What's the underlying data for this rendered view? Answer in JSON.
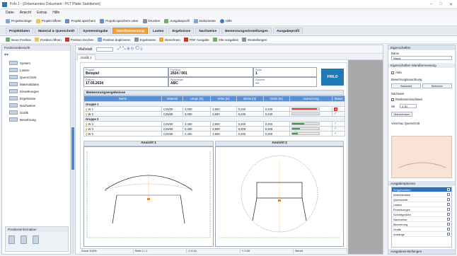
{
  "window": {
    "title": "Frilo 1 - [Unbenanntes Dokument - PLT Platte Stahlbeton]",
    "controls": [
      "–",
      "□",
      "✕"
    ]
  },
  "menu": [
    "Datei",
    "Ansicht",
    "Extras",
    "Hilfe"
  ],
  "toolbar1": [
    "Projektvorlage",
    "Projekt öffnen",
    "Projekt speichern",
    "Projekt speichern unter",
    "Drucken",
    "Ausgabeprofil",
    "Dokumente",
    "Hilfe"
  ],
  "ribbon_tabs": [
    "Projektdaten",
    "Material & Querschnitt",
    "Systemeingabe",
    "Wandbemessung",
    "Lasten",
    "Ergebnisse",
    "Nachweise",
    "Bemessungseinstellungen",
    "Ausgabeprofil"
  ],
  "ribbon_active": 3,
  "toolbar2": [
    "Neue Position",
    "Position öffnen",
    "Position löschen",
    "Position duplizieren",
    "Ergebnisse",
    "Berechnen",
    "PDF Ausgabe",
    "Alle Ausgaben",
    "Einstellungen"
  ],
  "left_pane": {
    "title": "Positionsübersicht",
    "items": [
      "System",
      "Lasten",
      "Querschnitt",
      "Materialdaten",
      "Einwirkungen",
      "Ergebnisse",
      "Nachweise",
      "Grafik",
      "Bewehrung"
    ],
    "footer_title": "Positionsinformation"
  },
  "main": {
    "toolbar_label": "Maßstab",
    "tab": "Grafik 1",
    "header": {
      "project_label": "Projekt",
      "project_value": "Beispiel",
      "position_label": "Position",
      "position_value": "2024 / 001",
      "date_label": "Datum",
      "date_value": "17.05.2024",
      "page_label": "Seite",
      "page_value": "1",
      "editor_label": "Bearbeiter",
      "editor_value": "ABC",
      "system_label": "System",
      "system_value": "—",
      "logo": "FRILO"
    },
    "section_title": "Bemessungsergebnisse",
    "table": {
      "headers": [
        "Name",
        "Material",
        "Länge [m]",
        "Höhe [m]",
        "Breite [m]",
        "Dicke [m]",
        "Ausnutzung",
        "Status"
      ],
      "groups": [
        {
          "name": "Gruppe 1",
          "rows": [
            {
              "name": "W 1",
              "mat": "C25/30",
              "l": "3,000",
              "h": "2,500",
              "b": "0,240",
              "d": "0,240",
              "util": 0.92,
              "color": "#d84e45",
              "status": "error"
            },
            {
              "name": "W 2",
              "mat": "C25/30",
              "l": "3,000",
              "h": "2,500",
              "b": "0,240",
              "d": "0,240",
              "util": 0.0,
              "color": "#d84e45",
              "status": "ok"
            }
          ]
        },
        {
          "name": "Gruppe 2",
          "rows": [
            {
              "name": "W 3",
              "mat": "C25/30",
              "l": "2,400",
              "h": "2,500",
              "b": "0,200",
              "d": "0,200",
              "util": 0.45,
              "color": "#3aa14a",
              "status": "ok"
            },
            {
              "name": "W 4",
              "mat": "C25/30",
              "l": "2,400",
              "h": "2,500",
              "b": "0,200",
              "d": "0,200",
              "util": 0.3,
              "color": "#3aa14a",
              "status": "ok"
            },
            {
              "name": "W 5",
              "mat": "C25/30",
              "l": "2,400",
              "h": "2,500",
              "b": "0,200",
              "d": "0,200",
              "util": 0.2,
              "color": "#3aa14a",
              "status": "ok"
            }
          ]
        }
      ]
    },
    "drawings": [
      "Ansicht 1",
      "Ansicht 2"
    ],
    "status": [
      "Zoom 100%",
      "Seite 1 / 1",
      "X 0.00",
      "Y 0.00",
      "Bereit"
    ]
  },
  "right_pane": {
    "title": "Eigenschaften",
    "name_label": "Name",
    "name_value": "Wand",
    "group_label": "Eigenschaften Wandbemessung",
    "opt1": "Aktiv",
    "layout_label": "Bewehrungsanordnung",
    "btn_a": "Standard",
    "btn_b": "Benutzer",
    "opt2": "Nachweis",
    "opt3": "Rissbreitennachweis",
    "value_label": "wk",
    "value": "0,30",
    "btn_c": "Übernehmen",
    "preview_label": "Vorschau Querschnitt",
    "list_title": "Ausgabeoptionen",
    "list": [
      {
        "label": "Eingabedaten",
        "selected": true
      },
      {
        "label": "Materialdaten",
        "selected": false
      },
      {
        "label": "Querschnitt",
        "selected": false
      },
      {
        "label": "Lasten",
        "selected": false
      },
      {
        "label": "Einwirkungen",
        "selected": false
      },
      {
        "label": "Schnittgrößen",
        "selected": false
      },
      {
        "label": "Nachweise",
        "selected": false
      },
      {
        "label": "Bewehrung",
        "selected": false
      },
      {
        "label": "Grafik",
        "selected": false
      },
      {
        "label": "Anhänge",
        "selected": false
      }
    ],
    "footer_title": "Ausgabeeinstellungen"
  },
  "colors": {
    "accent": "#f2a23a",
    "header_blue": "#5b8fd0",
    "split": "#4f86c6"
  }
}
